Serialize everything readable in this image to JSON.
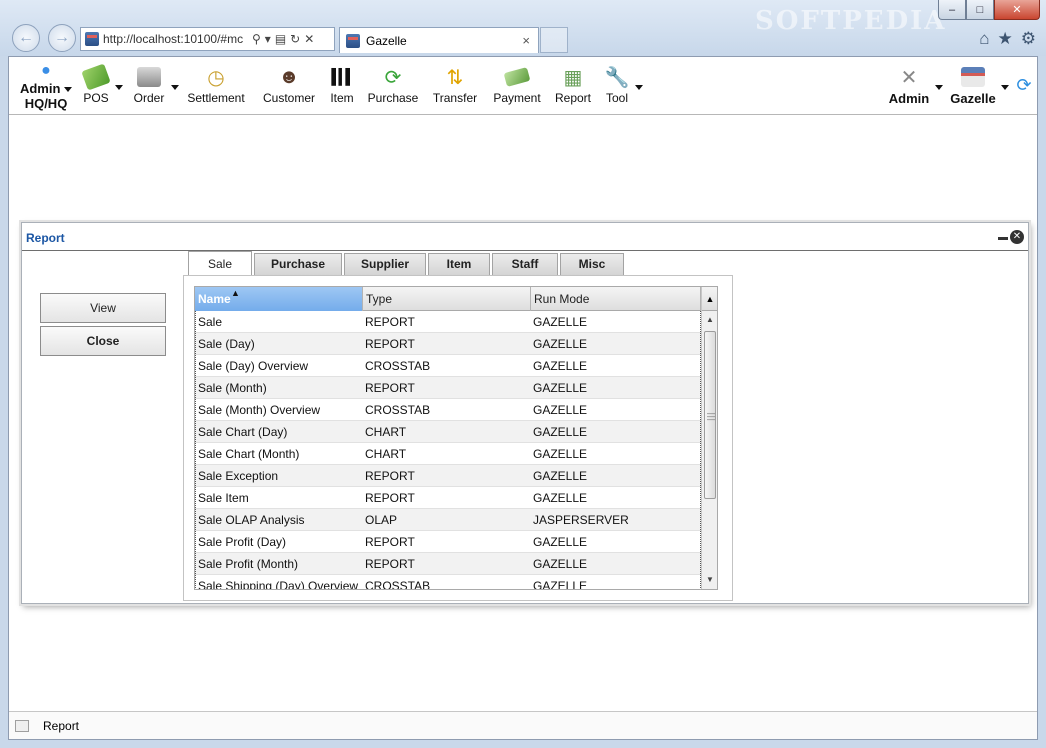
{
  "browser": {
    "url": "http://localhost:10100/#mc",
    "tab_title": "Gazelle",
    "tab_close": "×",
    "watermark": "SOFTPEDIA",
    "window_min": "–",
    "window_max": "□",
    "window_close": "✕"
  },
  "toolbar": {
    "admin_hq_line1": "Admin",
    "admin_hq_line2": "HQ/HQ",
    "pos": "POS",
    "order": "Order",
    "settlement": "Settlement",
    "customer": "Customer",
    "item": "Item",
    "purchase": "Purchase",
    "transfer": "Transfer",
    "payment": "Payment",
    "report": "Report",
    "tool": "Tool",
    "admin": "Admin",
    "gazelle": "Gazelle"
  },
  "report_window": {
    "title": "Report",
    "view_button": "View",
    "close_button": "Close",
    "tabs": [
      "Sale",
      "Purchase",
      "Supplier",
      "Item",
      "Staff",
      "Misc"
    ],
    "active_tab": "Sale",
    "columns": [
      "Name",
      "Type",
      "Run Mode"
    ],
    "sort_indicator": "▲",
    "rows": [
      [
        "Sale",
        "REPORT",
        "GAZELLE"
      ],
      [
        "Sale (Day)",
        "REPORT",
        "GAZELLE"
      ],
      [
        "Sale (Day) Overview",
        "CROSSTAB",
        "GAZELLE"
      ],
      [
        "Sale (Month)",
        "REPORT",
        "GAZELLE"
      ],
      [
        "Sale (Month) Overview",
        "CROSSTAB",
        "GAZELLE"
      ],
      [
        "Sale Chart (Day)",
        "CHART",
        "GAZELLE"
      ],
      [
        "Sale Chart (Month)",
        "CHART",
        "GAZELLE"
      ],
      [
        "Sale Exception",
        "REPORT",
        "GAZELLE"
      ],
      [
        "Sale Item",
        "REPORT",
        "GAZELLE"
      ],
      [
        "Sale OLAP Analysis",
        "OLAP",
        "JASPERSERVER"
      ],
      [
        "Sale Profit (Day)",
        "REPORT",
        "GAZELLE"
      ],
      [
        "Sale Profit (Month)",
        "REPORT",
        "GAZELLE"
      ],
      [
        "Sale Shipping (Day) Overview",
        "CROSSTAB",
        "GAZELLE"
      ]
    ]
  },
  "statusbar": {
    "text": "Report"
  }
}
